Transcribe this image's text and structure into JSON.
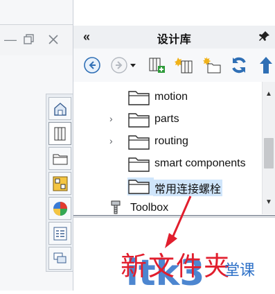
{
  "pane": {
    "title": "设计库",
    "collapse_glyph": "«"
  },
  "toolbar": {
    "buttons": [
      {
        "name": "back-icon"
      },
      {
        "name": "forward-icon"
      },
      {
        "name": "add-to-library-icon"
      },
      {
        "name": "add-file-location-icon"
      },
      {
        "name": "create-new-folder-icon"
      },
      {
        "name": "refresh-icon"
      },
      {
        "name": "up-one-level-icon"
      }
    ]
  },
  "tree": {
    "items": [
      {
        "label": "motion",
        "expandable": false,
        "selected": false
      },
      {
        "label": "parts",
        "expandable": true,
        "selected": false
      },
      {
        "label": "routing",
        "expandable": true,
        "selected": false
      },
      {
        "label": "smart components",
        "expandable": false,
        "selected": false
      },
      {
        "label": "常用连接螺栓",
        "expandable": false,
        "selected": true
      }
    ],
    "toolbox_label": "Toolbox"
  },
  "tabs": [
    {
      "name": "home-tab"
    },
    {
      "name": "design-library-tab"
    },
    {
      "name": "file-explorer-tab"
    },
    {
      "name": "view-palette-tab"
    },
    {
      "name": "appearances-tab"
    },
    {
      "name": "custom-properties-tab"
    },
    {
      "name": "forum-tab"
    }
  ],
  "watermark": {
    "text": "新文件夹",
    "domain": "itk3",
    "suffix": "堂课"
  },
  "colors": {
    "selection": "#cfe5fb",
    "watermark_red": "#e11e2d",
    "watermark_blue": "#2f72c8"
  }
}
